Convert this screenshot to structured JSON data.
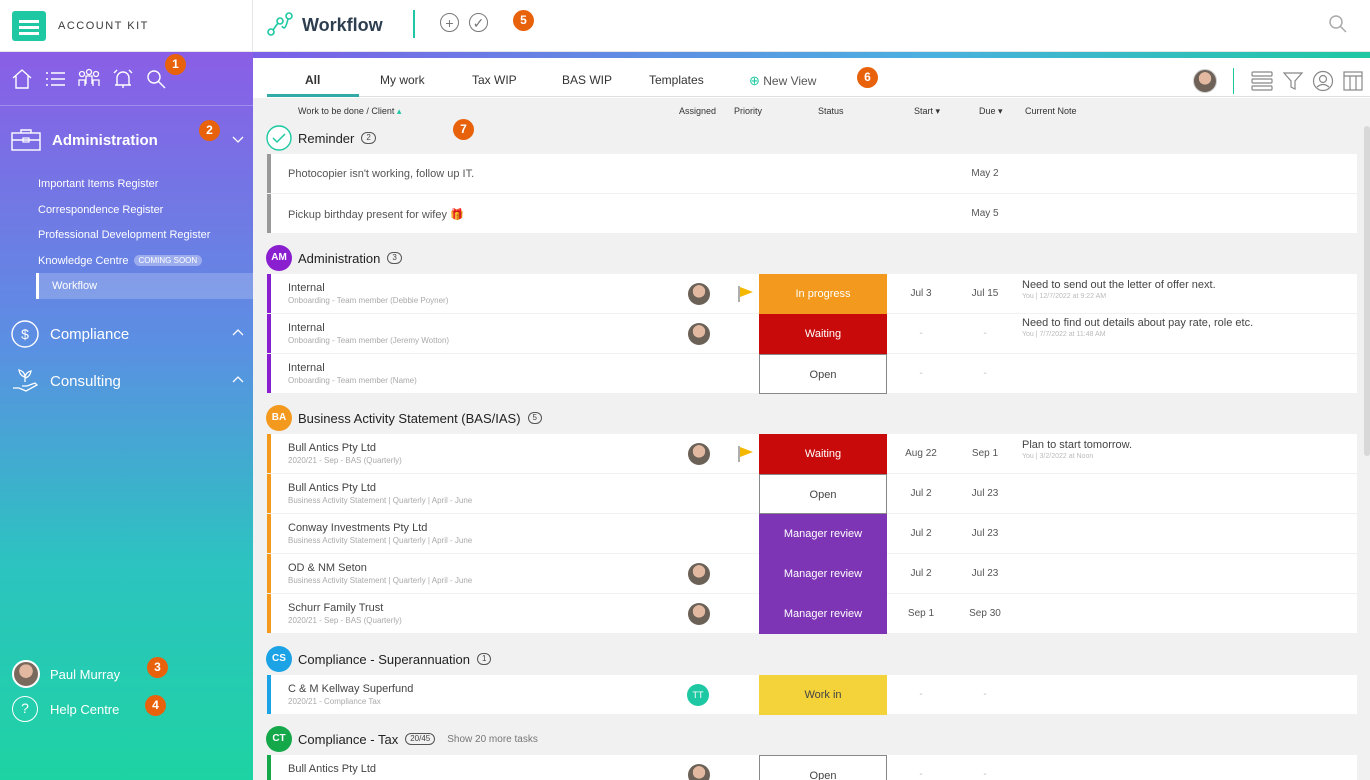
{
  "brand": {
    "name": "ACCOUNT KIT"
  },
  "header": {
    "title": "Workflow"
  },
  "badges": [
    "1",
    "2",
    "3",
    "4",
    "5",
    "6",
    "7"
  ],
  "sidebar": {
    "sections": [
      {
        "label": "Administration"
      },
      {
        "label": "Compliance"
      },
      {
        "label": "Consulting"
      }
    ],
    "admin_items": [
      {
        "label": "Important Items Register"
      },
      {
        "label": "Correspondence Register"
      },
      {
        "label": "Professional Development Register"
      },
      {
        "label": "Knowledge Centre",
        "pill": "COMING SOON"
      },
      {
        "label": "Workflow"
      }
    ],
    "user_name": "Paul Murray",
    "help_label": "Help Centre"
  },
  "tabs": [
    {
      "label": "All"
    },
    {
      "label": "My work"
    },
    {
      "label": "Tax WIP"
    },
    {
      "label": "BAS WIP"
    },
    {
      "label": "Templates"
    }
  ],
  "new_view_label": "New View",
  "columns": {
    "work": "Work to be done / Client",
    "assigned": "Assigned",
    "priority": "Priority",
    "status": "Status",
    "start": "Start",
    "due": "Due",
    "note": "Current Note"
  },
  "groups": {
    "reminder": {
      "name": "Reminder",
      "count": "2"
    },
    "admin": {
      "abbr": "AM",
      "name": "Administration",
      "count": "3"
    },
    "bas": {
      "abbr": "BA",
      "name": "Business Activity Statement (BAS/IAS)",
      "count": "5"
    },
    "cs": {
      "abbr": "CS",
      "name": "Compliance - Superannuation",
      "count": "1"
    },
    "ct": {
      "abbr": "CT",
      "name": "Compliance - Tax",
      "count": "20/45",
      "more": "Show 20 more tasks"
    }
  },
  "reminders": [
    {
      "text": "Photocopier isn't working, follow up IT.",
      "due": "May 2"
    },
    {
      "text": "Pickup birthday present for wifey 🎁",
      "due": "May 5"
    }
  ],
  "admin_rows": [
    {
      "title": "Internal",
      "sub": "Onboarding - Team member (Debbie Poyner)",
      "status": "In progress",
      "start": "Jul 3",
      "due": "Jul 15",
      "note": "Need to send out the letter of offer next.",
      "note_meta": "You | 12/7/2022 at 9:22 AM"
    },
    {
      "title": "Internal",
      "sub": "Onboarding - Team member (Jeremy Wotton)",
      "status": "Waiting",
      "start": "-",
      "due": "-",
      "note": "Need to find out details about pay rate, role etc.",
      "note_meta": "You | 7/7/2022 at 11:48 AM"
    },
    {
      "title": "Internal",
      "sub": "Onboarding - Team member (Name)",
      "status": "Open",
      "start": "-",
      "due": "-"
    }
  ],
  "bas_rows": [
    {
      "title": "Bull Antics Pty Ltd",
      "sub": "2020/21 - Sep - BAS (Quarterly)",
      "status": "Waiting",
      "start": "Aug 22",
      "due": "Sep 1",
      "note": "Plan to start tomorrow.",
      "note_meta": "You | 3/2/2022 at Noon"
    },
    {
      "title": "Bull Antics Pty Ltd",
      "sub": "Business Activity Statement | Quarterly | April - June",
      "status": "Open",
      "start": "Jul 2",
      "due": "Jul 23"
    },
    {
      "title": "Conway Investments Pty Ltd",
      "sub": "Business Activity Statement | Quarterly | April - June",
      "status": "Manager review",
      "start": "Jul 2",
      "due": "Jul 23"
    },
    {
      "title": "OD & NM Seton",
      "sub": "Business Activity Statement | Quarterly | April - June",
      "status": "Manager review",
      "start": "Jul 2",
      "due": "Jul 23"
    },
    {
      "title": "Schurr Family Trust",
      "sub": "2020/21 - Sep - BAS (Quarterly)",
      "status": "Manager review",
      "start": "Sep 1",
      "due": "Sep 30"
    }
  ],
  "cs_rows": [
    {
      "title": "C & M Kellway Superfund",
      "sub": "2020/21 - Compliance Tax",
      "assignee": "TT",
      "status": "Work in",
      "start": "-",
      "due": "-"
    }
  ],
  "ct_rows": [
    {
      "title": "Bull Antics Pty Ltd",
      "status": "Open",
      "start": "-",
      "due": "-"
    }
  ],
  "colors": {
    "accent": "#1ec8a2",
    "badge": "#e8620c",
    "admin": "#8a1fd0",
    "bas": "#f39a1e",
    "cs": "#1ba3e6",
    "ct": "#14a84a",
    "in_progress": "#f39a1e",
    "waiting": "#c80a0a",
    "manager_review": "#7e35b5",
    "work_in": "#f3d23a"
  }
}
